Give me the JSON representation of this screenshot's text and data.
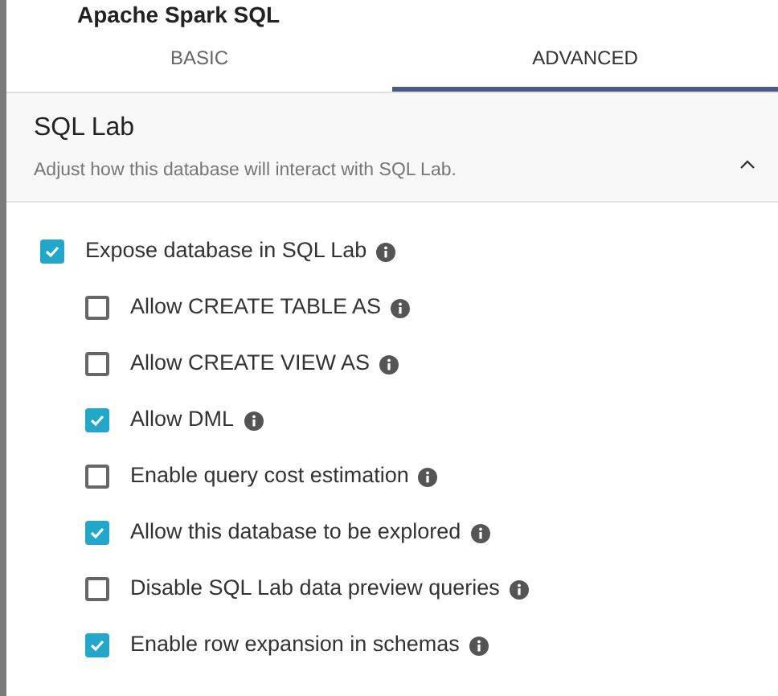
{
  "modal_title": "Apache Spark SQL",
  "tabs": [
    {
      "label": "BASIC",
      "selected": false
    },
    {
      "label": "ADVANCED",
      "selected": true
    }
  ],
  "section": {
    "title": "SQL Lab",
    "description": "Adjust how this database will interact with SQL Lab.",
    "expanded": true,
    "options": [
      {
        "label": "Expose database in SQL Lab",
        "checked": true,
        "children": [
          {
            "label": "Allow CREATE TABLE AS",
            "checked": false
          },
          {
            "label": "Allow CREATE VIEW AS",
            "checked": false
          },
          {
            "label": "Allow DML",
            "checked": true
          },
          {
            "label": "Enable query cost estimation",
            "checked": false
          },
          {
            "label": "Allow this database to be explored",
            "checked": true
          },
          {
            "label": "Disable SQL Lab data preview queries",
            "checked": false
          },
          {
            "label": "Enable row expansion in schemas",
            "checked": true
          }
        ]
      }
    ]
  }
}
